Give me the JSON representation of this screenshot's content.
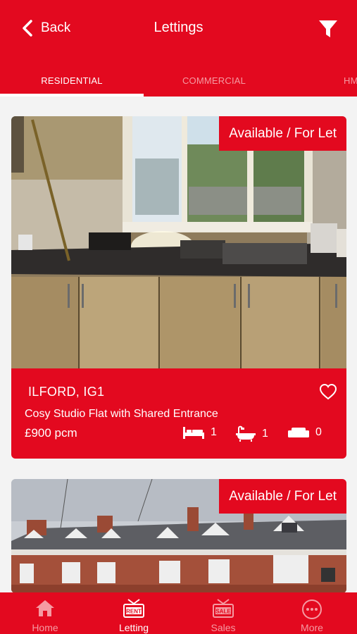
{
  "header": {
    "back_label": "Back",
    "title": "Lettings",
    "filter_icon": "filter-icon"
  },
  "tabs": [
    {
      "label": "RESIDENTIAL",
      "active": true
    },
    {
      "label": "COMMERCIAL",
      "active": false
    },
    {
      "label": "HM",
      "active": false
    }
  ],
  "listings": [
    {
      "status": "Available / For Let",
      "location": "ILFORD, IG1",
      "title": "Cosy Studio Flat with Shared Entrance",
      "price": "£900 pcm",
      "bedrooms": "1",
      "bathrooms": "1",
      "receptions": "0",
      "favorite": false
    },
    {
      "status": "Available / For Let"
    }
  ],
  "bottom_nav": [
    {
      "label": "Home",
      "icon": "home-icon",
      "active": false
    },
    {
      "label": "Letting",
      "icon": "rent-sign-icon",
      "icon_text": "RENT",
      "active": true
    },
    {
      "label": "Sales",
      "icon": "sale-sign-icon",
      "icon_text": "SALE",
      "active": false
    },
    {
      "label": "More",
      "icon": "more-icon",
      "active": false
    }
  ],
  "colors": {
    "brand_red": "#e3091f",
    "inactive": "#f59aa2",
    "background": "#f3f3f3"
  }
}
